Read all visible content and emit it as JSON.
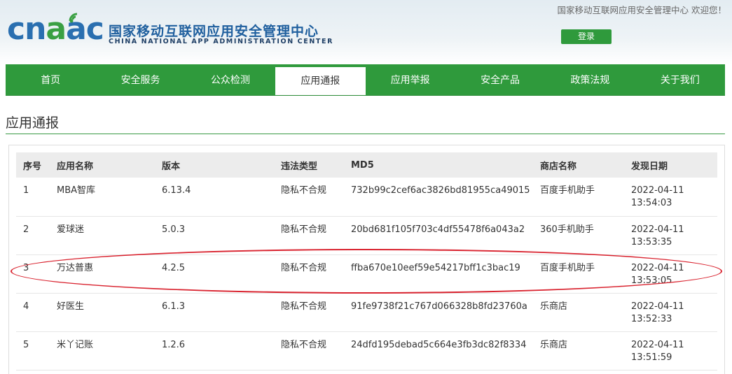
{
  "header": {
    "logo_text": "cnaac",
    "org_cn": "国家移动互联网应用安全管理中心",
    "org_en": "CHINA NATIONAL APP ADMINISTRATION CENTER",
    "welcome": "国家移动互联网应用安全管理中心 欢迎您！",
    "login_label": "登录"
  },
  "nav": {
    "items": [
      {
        "label": "首页"
      },
      {
        "label": "安全服务"
      },
      {
        "label": "公众检测"
      },
      {
        "label": "应用通报"
      },
      {
        "label": "应用举报"
      },
      {
        "label": "安全产品"
      },
      {
        "label": "政策法规"
      },
      {
        "label": "关于我们"
      }
    ],
    "active_index": 3
  },
  "page": {
    "title": "应用通报"
  },
  "table": {
    "columns": [
      "序号",
      "应用名称",
      "版本",
      "违法类型",
      "MD5",
      "商店名称",
      "发现日期"
    ],
    "rows": [
      {
        "no": "1",
        "name": "MBA智库",
        "version": "6.13.4",
        "type": "隐私不合规",
        "md5": "732b99c2cef6ac3826bd81955ca49015",
        "store": "百度手机助手",
        "date": "2022-04-11",
        "time": "13:54:03"
      },
      {
        "no": "2",
        "name": "爱球迷",
        "version": "5.0.3",
        "type": "隐私不合规",
        "md5": "20bd681f105f703c4df55478f6a043a2",
        "store": "360手机助手",
        "date": "2022-04-11",
        "time": "13:53:35"
      },
      {
        "no": "3",
        "name": "万达普惠",
        "version": "4.2.5",
        "type": "隐私不合规",
        "md5": "ffba670e10eef59e54217bff1c3bac19",
        "store": "百度手机助手",
        "date": "2022-04-11",
        "time": "13:53:05"
      },
      {
        "no": "4",
        "name": "好医生",
        "version": "6.1.3",
        "type": "隐私不合规",
        "md5": "91fe9738f21c767d066328b8fd23760a",
        "store": "乐商店",
        "date": "2022-04-11",
        "time": "13:52:33"
      },
      {
        "no": "5",
        "name": "米丫记账",
        "version": "1.2.6",
        "type": "隐私不合规",
        "md5": "24dfd195debad5c664e3fb3dc82f8334",
        "store": "乐商店",
        "date": "2022-04-11",
        "time": "13:51:59"
      }
    ]
  },
  "colors": {
    "brand_green": "#2f9a3c",
    "brand_blue": "#2a6fb0",
    "highlight_red": "#d9232f"
  }
}
